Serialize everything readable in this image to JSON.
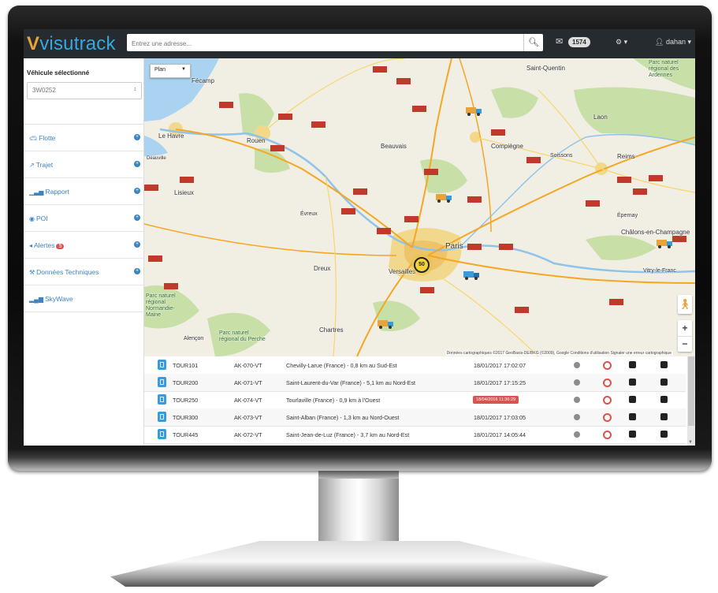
{
  "brand": {
    "name": "visutrack",
    "logo_mark": "V"
  },
  "header": {
    "search_placeholder": "Entrez une adresse...",
    "search_icon": "search-icon",
    "mail_icon": "envelope-icon",
    "mail_count": "1574",
    "settings_icon": "gear-icon",
    "settings_caret": "▾",
    "user_icon": "user-icon",
    "user_name": "dahan"
  },
  "sidebar": {
    "vehicle_label": "Véhicule sélectionné",
    "vehicle_value": "3W0252",
    "items": [
      {
        "icon": "car-icon",
        "label": "Flotte"
      },
      {
        "icon": "route-icon",
        "label": "Trajet"
      },
      {
        "icon": "bar-chart-icon",
        "label": "Rapport"
      },
      {
        "icon": "map-marker-icon",
        "label": "POI"
      },
      {
        "icon": "bullhorn-icon",
        "label": "Alertes",
        "badge": "5"
      },
      {
        "icon": "wrench-icon",
        "label": "Données Techniques"
      },
      {
        "icon": "signal-icon",
        "label": "SkyWave"
      }
    ]
  },
  "map": {
    "type_selector": "Plan",
    "cluster_count": "50",
    "labels": {
      "le_havre": "Le Havre",
      "fecamp": "Fécamp",
      "rouen": "Rouen",
      "beauvais": "Beauvais",
      "compiegne": "Compiègne",
      "saint_quentin": "Saint-Quentin",
      "laon": "Laon",
      "soissons": "Soissons",
      "reims": "Reims",
      "epernay": "Épernay",
      "chalons": "Châlons-en-Champagne",
      "vitry": "Vitry-le-Franc",
      "lisieux": "Lisieux",
      "evreux": "Évreux",
      "paris": "Paris",
      "versailles": "Versailles",
      "dreux": "Dreux",
      "chartres": "Chartres",
      "alencon": "Alençon",
      "deauville": "Deauville",
      "pnr_perche": "Parc naturel régional du Perche",
      "pnr_normandie": "Parc naturel régional Normandie-Maine",
      "pnr_ardennes": "Parc naturel régional des Ardennes"
    },
    "attribution": "Données cartographiques ©2017 GeoBasis-DE/BKG (©2009), Google   Conditions d'utilisation   Signaler une erreur cartographique"
  },
  "table": {
    "rows": [
      {
        "name": "TOUR101",
        "plate": "AK-070-VT",
        "location": "Chevilly-Larue (France) - 0,8 km au Sud-Est",
        "datetime": "18/01/2017 17:02:07",
        "alert": false
      },
      {
        "name": "TOUR200",
        "plate": "AK-071-VT",
        "location": "Saint-Laurent-du-Var (France) - 5,1 km au Nord-Est",
        "datetime": "18/01/2017 17:15:25",
        "alert": false
      },
      {
        "name": "TOUR250",
        "plate": "AK-074-VT",
        "location": "Tourlaville (France) - 0,9 km à l'Ouest",
        "datetime": "18/04/2016 11:36:29",
        "alert": true
      },
      {
        "name": "TOUR300",
        "plate": "AK-073-VT",
        "location": "Saint-Alban (France) - 1,3 km au Nord-Ouest",
        "datetime": "18/01/2017 17:03:05",
        "alert": false
      },
      {
        "name": "TOUR445",
        "plate": "AK-072-VT",
        "location": "Saint-Jean-de-Luz (France) - 3,7 km au Nord-Est",
        "datetime": "18/01/2017 14:05:44",
        "alert": false
      }
    ]
  },
  "colors": {
    "navbar": "#262b30",
    "brand": "#39a7df",
    "accent": "#3b83c4",
    "alert": "#d9534f",
    "sea": "#a9d3f0",
    "forest": "#c8dfa8",
    "urban": "#f2d88c"
  }
}
